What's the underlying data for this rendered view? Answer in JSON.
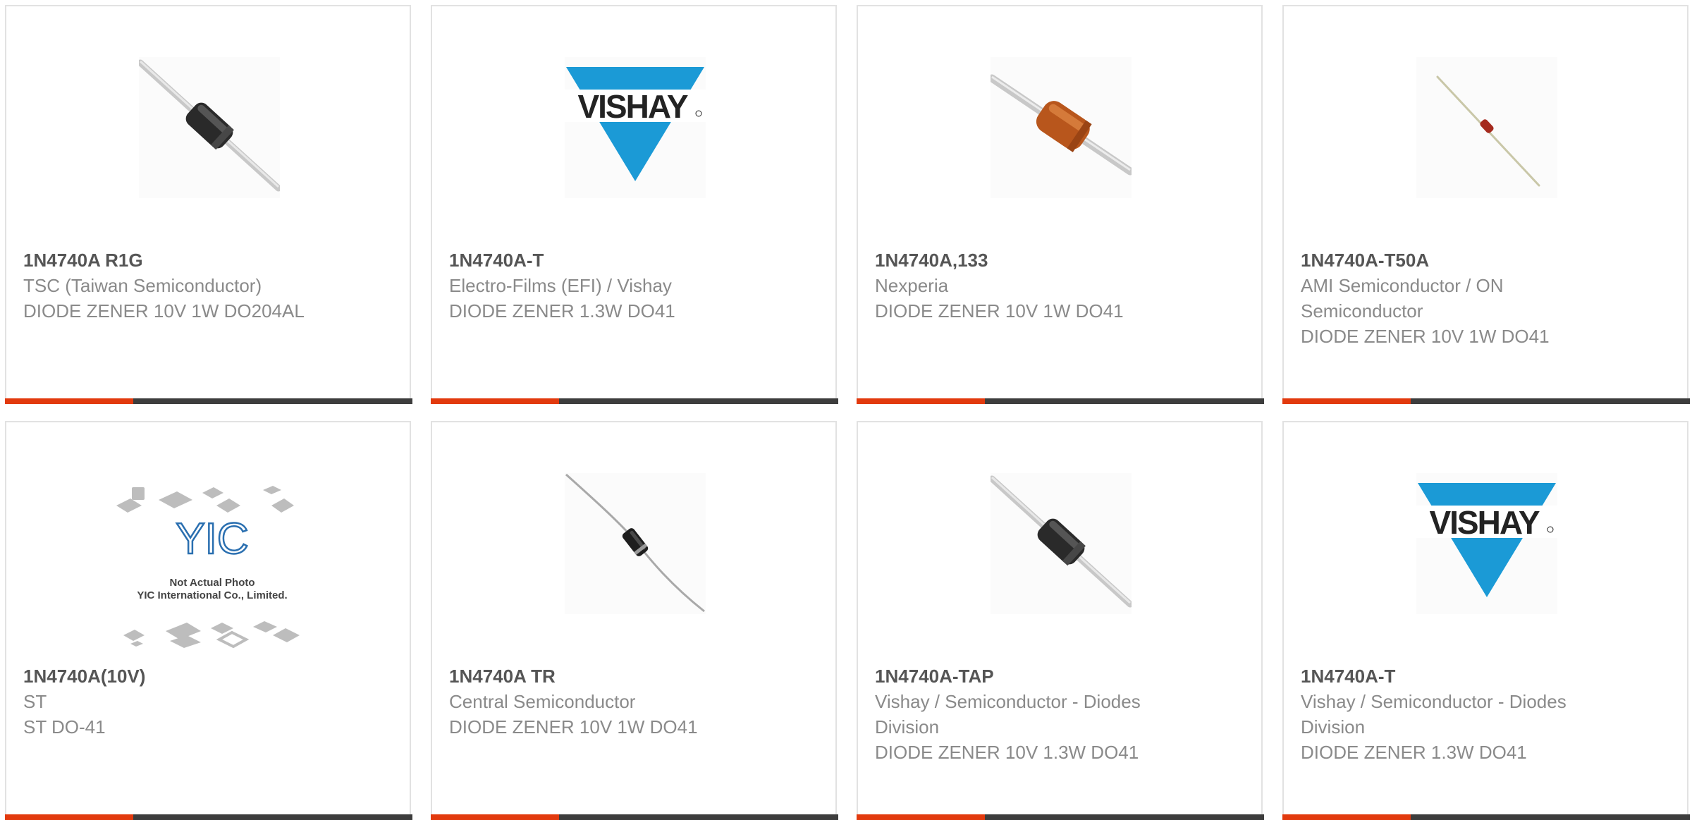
{
  "colors": {
    "accent": "#e23a0e",
    "bar": "#3d3d3d",
    "border": "#e2e2e2",
    "part_number": "#555555",
    "secondary_text": "#8a8a8a",
    "vishay_blue": "#1b9ad6"
  },
  "products": [
    {
      "part_number": "1N4740A R1G",
      "manufacturer": "TSC (Taiwan Semiconductor)",
      "description": "DIODE ZENER 10V 1W DO204AL",
      "image": "black-axial-diode"
    },
    {
      "part_number": "1N4740A-T",
      "manufacturer": "Electro-Films (EFI) / Vishay",
      "description": "DIODE ZENER 1.3W DO41",
      "image": "vishay-logo"
    },
    {
      "part_number": "1N4740A,133",
      "manufacturer": "Nexperia",
      "description": "DIODE ZENER 10V 1W DO41",
      "image": "orange-axial-diode"
    },
    {
      "part_number": "1N4740A-T50A",
      "manufacturer": "AMI Semiconductor / ON Semiconductor",
      "description": "DIODE ZENER 10V 1W DO41",
      "image": "small-red-diode"
    },
    {
      "part_number": "1N4740A(10V)",
      "manufacturer": "ST",
      "description": "ST DO-41",
      "image": "yic-placeholder",
      "placeholder_lines": [
        "Not Actual Photo",
        "YIC International Co., Limited."
      ]
    },
    {
      "part_number": "1N4740A TR",
      "manufacturer": "Central Semiconductor",
      "description": "DIODE ZENER 10V 1W DO41",
      "image": "thin-black-diode"
    },
    {
      "part_number": "1N4740A-TAP",
      "manufacturer": "Vishay / Semiconductor - Diodes Division",
      "description": "DIODE ZENER 10V 1.3W DO41",
      "image": "black-axial-diode"
    },
    {
      "part_number": "1N4740A-T",
      "manufacturer": "Vishay / Semiconductor - Diodes Division",
      "description": "DIODE ZENER 1.3W DO41",
      "image": "vishay-logo"
    }
  ]
}
